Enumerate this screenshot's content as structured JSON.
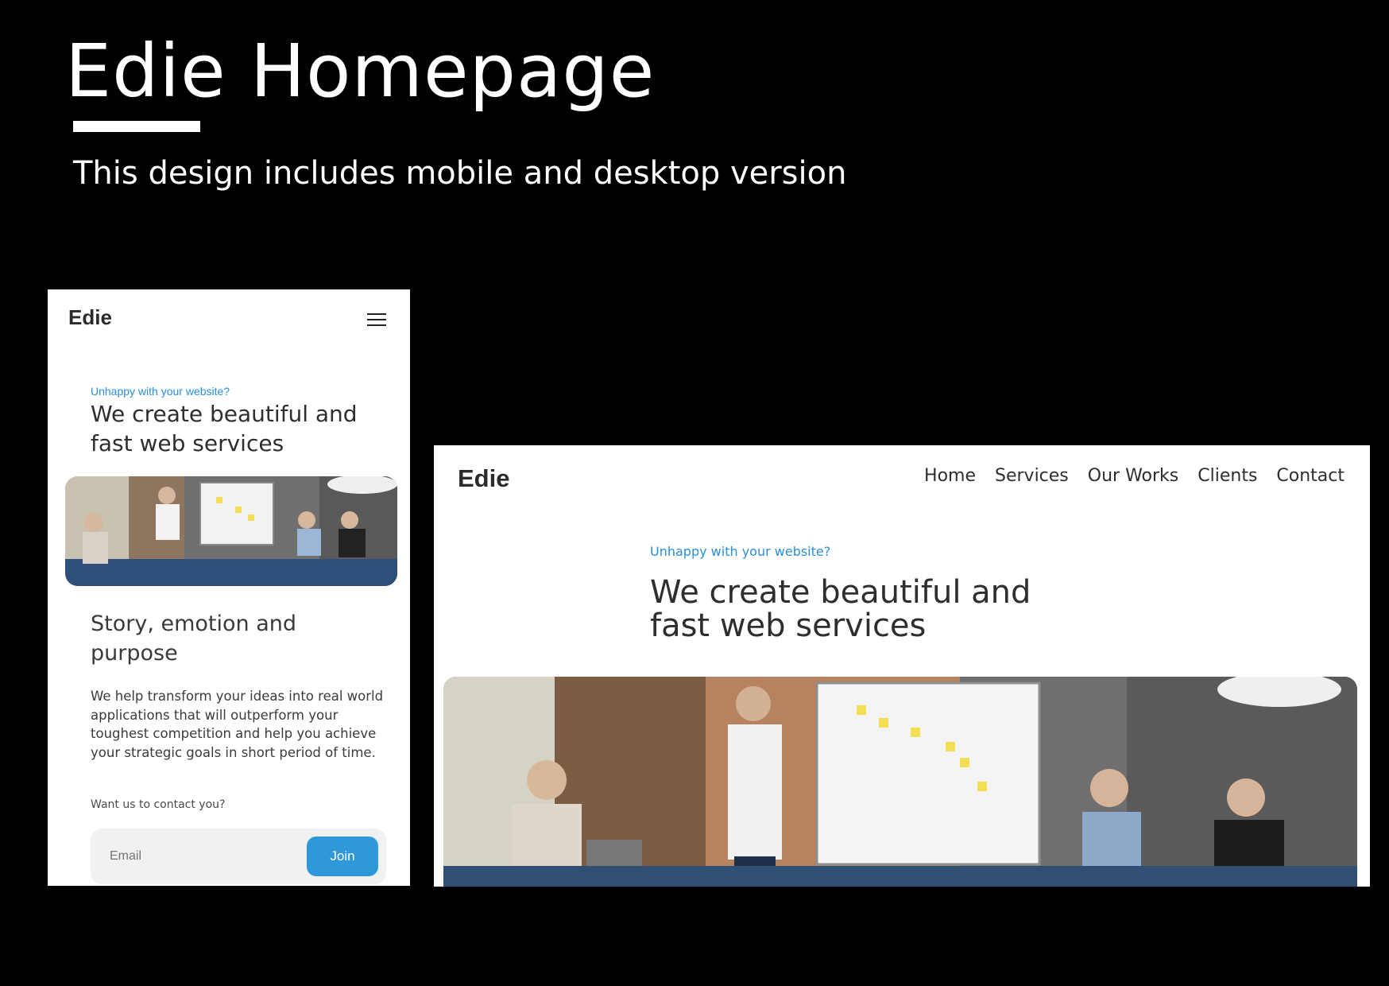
{
  "page": {
    "title": "Edie Homepage",
    "subtitle": "This design includes mobile and desktop version"
  },
  "mobile": {
    "logo": "Edie",
    "menu_icon": "hamburger-menu-icon",
    "eyebrow": "Unhappy with your website?",
    "headline": "We create beautiful and fast web services",
    "hero_image": "team-meeting-whiteboard-photo",
    "section_title": "Story, emotion and purpose",
    "body": "We help transform your ideas into real world applications that will outperform your toughest competition and help you achieve your strategic goals in short period of time.",
    "contact_prompt": "Want us to contact you?",
    "email_placeholder": "Email",
    "join_label": "Join"
  },
  "desktop": {
    "logo": "Edie",
    "nav": [
      "Home",
      "Services",
      "Our Works",
      "Clients",
      "Contact"
    ],
    "eyebrow": "Unhappy with your website?",
    "headline": "We create beautiful and fast web services",
    "hero_image": "team-meeting-whiteboard-photo"
  },
  "colors": {
    "background": "#000000",
    "accent": "#2e98d9",
    "text": "#2e2e2e"
  }
}
